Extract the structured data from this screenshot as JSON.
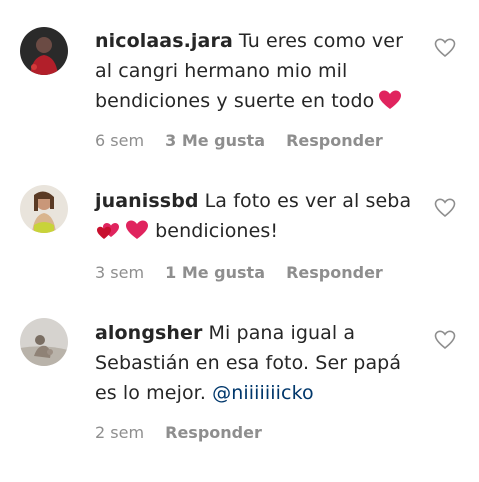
{
  "comments": [
    {
      "username": "nicolaas.jara",
      "text": "Tu eres como ver al cangri hermano mio mil bendiciones y suerte en todo",
      "time": "6 sem",
      "likes": "3 Me gusta",
      "reply": "Responder",
      "avatar_icon": "user-avatar-photo",
      "emojis": [
        "red-heart"
      ]
    },
    {
      "username": "juanissbd",
      "text_before": "La foto es ver al seba",
      "text_after": "bendiciones!",
      "time": "3 sem",
      "likes": "1 Me gusta",
      "reply": "Responder",
      "avatar_icon": "user-avatar-photo",
      "emojis": [
        "two-hearts",
        "red-heart"
      ]
    },
    {
      "username": "alongsher",
      "text": "Mi pana igual a Sebastián en esa foto. Ser papá es lo mejor.",
      "mention": "@niiiiiiicko",
      "time": "2 sem",
      "reply": "Responder",
      "avatar_icon": "user-avatar-photo"
    }
  ],
  "colors": {
    "text": "#262626",
    "meta": "#8e8e8e",
    "mention": "#00376b",
    "heart_emoji": "#e0245e"
  }
}
